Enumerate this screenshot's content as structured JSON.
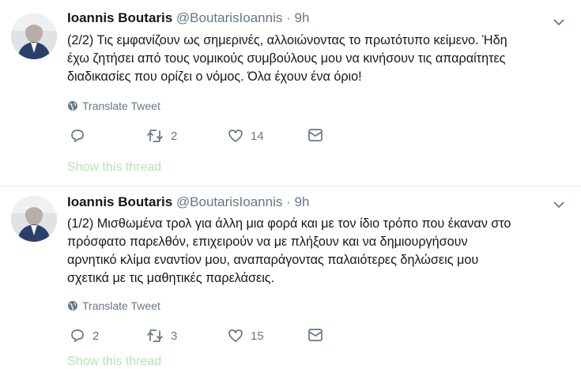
{
  "tweets": [
    {
      "name": "Ioannis Boutaris",
      "handle": "@BoutarisIoannis",
      "separator": "·",
      "time": "9h",
      "lines": [
        "(2/2) Τις εμφανίζουν ως σημερινές, αλλοιώνοντας το πρωτότυπο κείμενο. Ήδη",
        "έχω ζητήσει από τους νομικούς συμβούλους μου να κινήσουν τις απαραίτητες",
        "διαδικασίες που ορίζει ο νόμος. Όλα έχουν ένα όριο!"
      ],
      "translate_label": "Translate Tweet",
      "reply_count": "",
      "retweet_count": "2",
      "like_count": "14",
      "show_thread_label": "Show this thread"
    },
    {
      "name": "Ioannis Boutaris",
      "handle": "@BoutarisIoannis",
      "separator": "·",
      "time": "9h",
      "lines": [
        "(1/2) Μισθωμένα τρολ για άλλη μια φορά και με τον ίδιο τρόπο που έκαναν στο",
        "πρόσφατο παρελθόν, επιχειρούν να με πλήξουν και να δημιουργήσουν",
        "αρνητικό κλίμα εναντίον μου, αναπαράγοντας παλαιότερες δηλώσεις μου",
        "σχετικά με τις μαθητικές παρελάσεις."
      ],
      "translate_label": "Translate Tweet",
      "reply_count": "2",
      "retweet_count": "3",
      "like_count": "15",
      "show_thread_label": "Show this thread"
    }
  ],
  "icons": {
    "globe": "globe-icon",
    "reply": "reply-icon",
    "retweet": "retweet-icon",
    "like": "heart-icon",
    "dm": "envelope-icon",
    "caret": "chevron-down-icon"
  },
  "colors": {
    "text": "#14171a",
    "muted": "#657786",
    "show_thread": "#b7e1b4",
    "divider": "#e6ecf0"
  }
}
